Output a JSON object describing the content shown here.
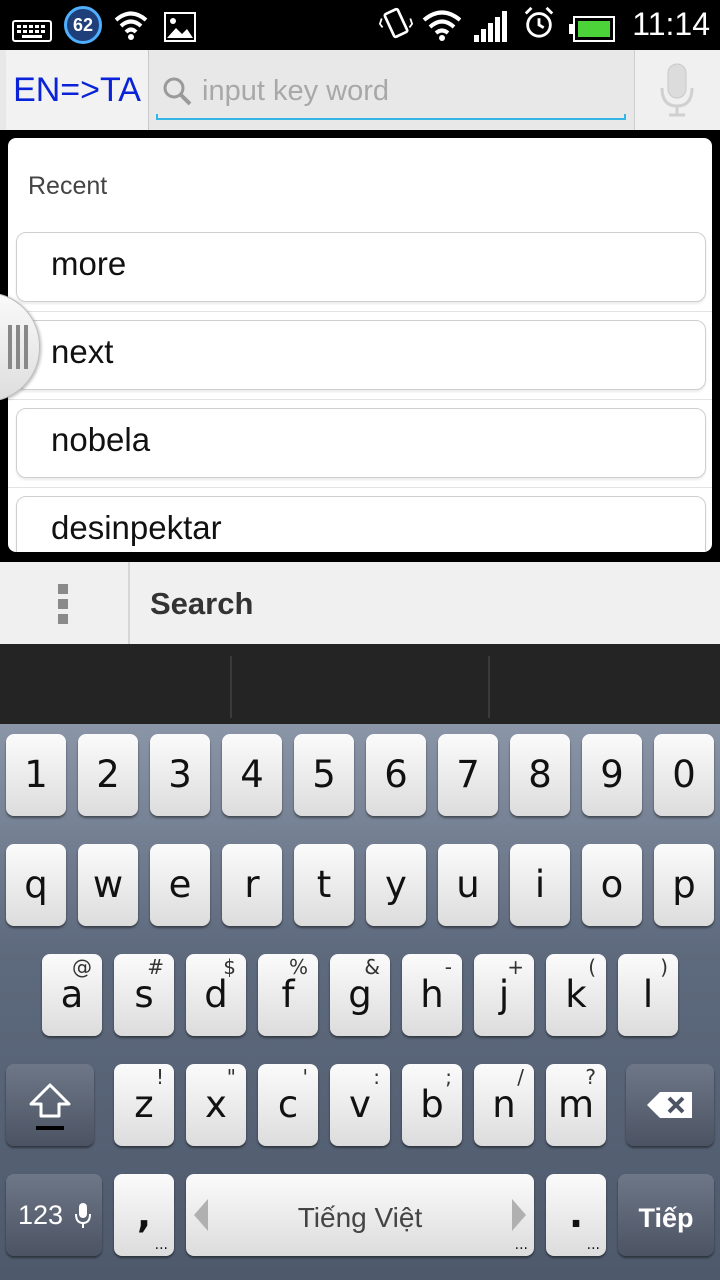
{
  "status_bar": {
    "time": "11:14",
    "notification_badge": "62",
    "icons_left": [
      "keyboard-icon",
      "badge-62-icon",
      "wifi-icon",
      "image-icon"
    ],
    "icons_right": [
      "vibrate-icon",
      "wifi-icon",
      "signal-icon",
      "alarm-icon",
      "battery-icon"
    ]
  },
  "topbar": {
    "lang_label": "EN=>TA",
    "search_placeholder": "input key word"
  },
  "recent": {
    "title": "Recent",
    "items": [
      {
        "label": "more"
      },
      {
        "label": "next"
      },
      {
        "label": "nobela"
      },
      {
        "label": "desinpektar"
      }
    ]
  },
  "action_bar": {
    "search_label": "Search"
  },
  "keyboard": {
    "number_row": [
      "1",
      "2",
      "3",
      "4",
      "5",
      "6",
      "7",
      "8",
      "9",
      "0"
    ],
    "row1": [
      "q",
      "w",
      "e",
      "r",
      "t",
      "y",
      "u",
      "i",
      "o",
      "p"
    ],
    "row2": [
      {
        "k": "a",
        "alt": "@"
      },
      {
        "k": "s",
        "alt": "#"
      },
      {
        "k": "d",
        "alt": "$"
      },
      {
        "k": "f",
        "alt": "%"
      },
      {
        "k": "g",
        "alt": "&"
      },
      {
        "k": "h",
        "alt": "-"
      },
      {
        "k": "j",
        "alt": "+"
      },
      {
        "k": "k",
        "alt": "("
      },
      {
        "k": "l",
        "alt": ")"
      }
    ],
    "row3": [
      {
        "k": "z",
        "alt": "!"
      },
      {
        "k": "x",
        "alt": "\""
      },
      {
        "k": "c",
        "alt": "'"
      },
      {
        "k": "v",
        "alt": ":"
      },
      {
        "k": "b",
        "alt": ";"
      },
      {
        "k": "n",
        "alt": "/"
      },
      {
        "k": "m",
        "alt": "?"
      }
    ],
    "symbols_key": "123",
    "comma_key": ",",
    "space_label": "Tiếng Việt",
    "period_key": ".",
    "enter_label": "Tiếp"
  },
  "colors": {
    "lang_label": "#0a23d8",
    "search_underline": "#33b5e5",
    "keyboard_bg": "#5e6a7d"
  }
}
